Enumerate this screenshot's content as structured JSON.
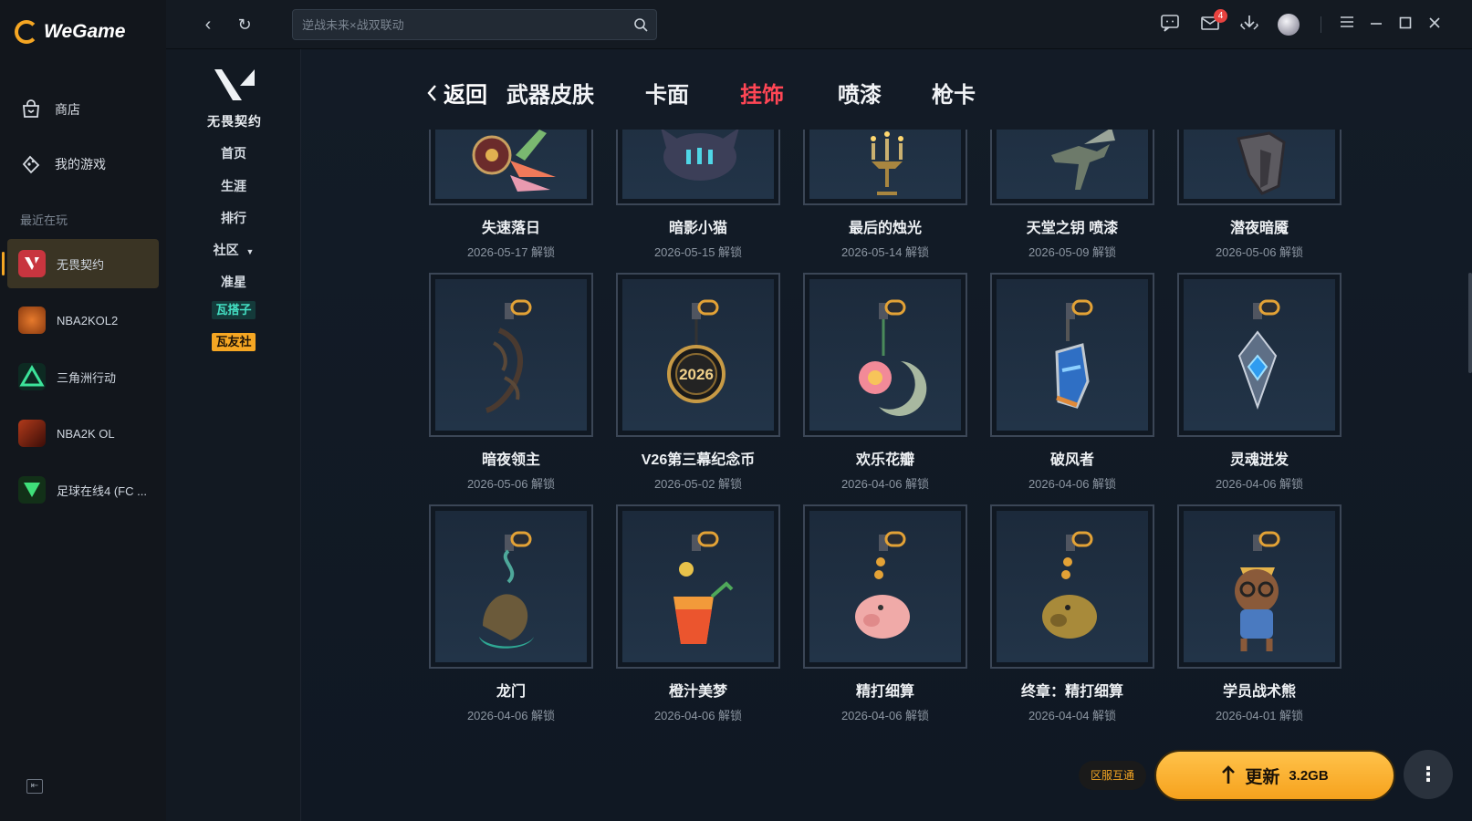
{
  "app": {
    "logo_text": "WeGame"
  },
  "sidebar": {
    "nav": [
      {
        "label": "商店",
        "icon": "shop-bag-icon"
      },
      {
        "label": "我的游戏",
        "icon": "gamepad-icon"
      }
    ],
    "recent_label": "最近在玩",
    "recent": [
      {
        "label": "无畏契约",
        "icon": "valorant-icon",
        "active": true
      },
      {
        "label": "NBA2KOL2",
        "icon": "nba2kol2-icon"
      },
      {
        "label": "三角洲行动",
        "icon": "delta-force-icon"
      },
      {
        "label": "NBA2K OL",
        "icon": "nba2k-ol-icon"
      },
      {
        "label": "足球在线4 (FC ...",
        "icon": "fc-online-icon"
      }
    ]
  },
  "topbar": {
    "search_placeholder": "逆战未来×战双联动",
    "mail_badge": "4"
  },
  "game_side": {
    "logo_text": "无畏契约",
    "items": [
      "首页",
      "生涯",
      "排行",
      "社区",
      "准星"
    ],
    "tags": [
      "瓦搭子",
      "瓦友社"
    ]
  },
  "tabs": {
    "back": "返回",
    "items": [
      "武器皮肤",
      "卡面",
      "挂饰",
      "喷漆",
      "枪卡"
    ],
    "active": "挂饰"
  },
  "items": [
    {
      "name": "失速落日",
      "date": "2026-05-17 解锁"
    },
    {
      "name": "暗影小猫",
      "date": "2026-05-15 解锁"
    },
    {
      "name": "最后的烛光",
      "date": "2026-05-14 解锁"
    },
    {
      "name": "天堂之钥 喷漆",
      "date": "2026-05-09 解锁"
    },
    {
      "name": "潜夜暗魇",
      "date": "2026-05-06 解锁"
    },
    {
      "name": "暗夜领主",
      "date": "2026-05-06 解锁"
    },
    {
      "name": "V26第三幕纪念币",
      "date": "2026-05-02 解锁"
    },
    {
      "name": "欢乐花瓣",
      "date": "2026-04-06 解锁"
    },
    {
      "name": "破风者",
      "date": "2026-04-06 解锁"
    },
    {
      "name": "灵魂迸发",
      "date": "2026-04-06 解锁"
    },
    {
      "name": "龙门",
      "date": "2026-04-06 解锁"
    },
    {
      "name": "橙汁美梦",
      "date": "2026-04-06 解锁"
    },
    {
      "name": "精打细算",
      "date": "2026-04-06 解锁"
    },
    {
      "name": "终章：精打细算",
      "date": "2026-04-04 解锁"
    },
    {
      "name": "学员战术熊",
      "date": "2026-04-01 解锁"
    }
  ],
  "coin_text": "2026",
  "footer": {
    "region": "区服互通",
    "update_label": "更新",
    "update_size": "3.2GB",
    "more": "⋮"
  },
  "colors": {
    "accent": "#f5a623",
    "active_tab": "#ff4655"
  }
}
